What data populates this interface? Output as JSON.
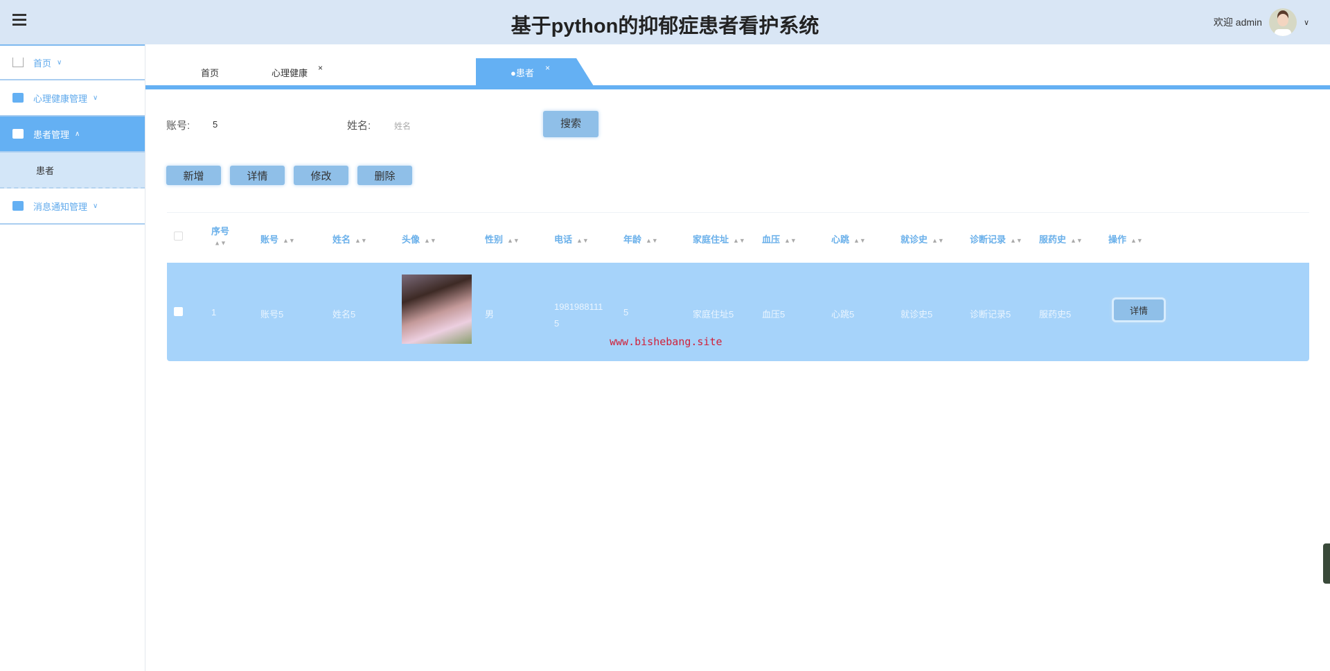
{
  "header": {
    "title": "基于python的抑郁症患者看护系统",
    "welcome": "欢迎 admin"
  },
  "sidebar": {
    "items": [
      {
        "label": "首页",
        "icon": "home-icon"
      },
      {
        "label": "心理健康管理",
        "icon": "briefcase-icon"
      },
      {
        "label": "患者管理",
        "icon": "chart-icon",
        "sub": "患者"
      },
      {
        "label": "消息通知管理",
        "icon": "toggle-icon"
      }
    ]
  },
  "tabs": [
    {
      "label": "首页"
    },
    {
      "label": "心理健康",
      "close": "×"
    },
    {
      "label": "●患者",
      "close": "×"
    }
  ],
  "search": {
    "account_label": "账号:",
    "account_value": "5",
    "name_label": "姓名:",
    "name_placeholder": "姓名",
    "search_button": "搜索"
  },
  "actions": {
    "add": "新增",
    "detail": "详情",
    "edit": "修改",
    "delete": "删除"
  },
  "table": {
    "columns": [
      "序号",
      "账号",
      "姓名",
      "头像",
      "性别",
      "电话",
      "年龄",
      "家庭住址",
      "血压",
      "心跳",
      "就诊史",
      "诊断记录",
      "服药史",
      "操作"
    ],
    "rows": [
      {
        "index": "1",
        "account": "账号5",
        "name": "姓名5",
        "gender": "男",
        "phone1": "1981988111",
        "phone2": "5",
        "age": "5",
        "address": "家庭住址5",
        "bp": "血压5",
        "heart": "心跳5",
        "visits": "就诊史5",
        "diagnosis": "诊断记录5",
        "meds": "服药史5",
        "detail_button": "详情"
      }
    ]
  },
  "watermark": "www.bishebang.site",
  "colors": {
    "accent": "#64b0f3",
    "header_bg": "#d9e6f5",
    "row_bg": "#a6d3fa",
    "button": "#8fbfe8"
  }
}
